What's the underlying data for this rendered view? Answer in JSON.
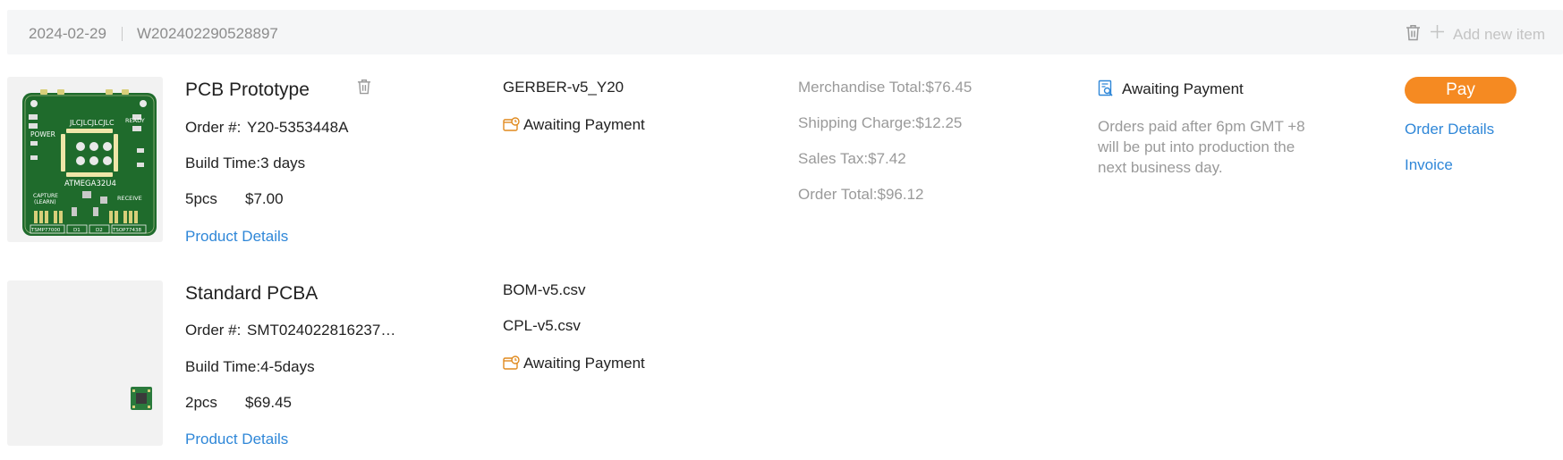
{
  "header": {
    "date": "2024-02-29",
    "order_number": "W202402290528897",
    "add_item_label": "Add new item"
  },
  "items": [
    {
      "board_text": {
        "power": "POWER",
        "ready": "READY",
        "brand": "JLCJLCJLCJLC",
        "chip": "ATMEGA32U4",
        "capture": "CAPTURE",
        "learn": "(LEARN)",
        "receive": "RECEIVE",
        "tsop1": "TSMP77000",
        "d1": "D1",
        "d2": "D2",
        "tsop2": "TSOP77438"
      },
      "title": "PCB Prototype",
      "order_label": "Order #:",
      "order_value": "Y20-5353448A",
      "build_time": "Build Time:3 days",
      "qty": "5pcs",
      "price": "$7.00",
      "details_link": "Product Details",
      "file": "GERBER-v5_Y20",
      "file_status": "Awaiting Payment"
    },
    {
      "title": "Standard PCBA",
      "order_label": "Order #:",
      "order_value": "SMT024022816237…",
      "build_time": "Build Time:4-5days",
      "qty": "2pcs",
      "price": "$69.45",
      "details_link": "Product Details",
      "files": [
        "BOM-v5.csv",
        "CPL-v5.csv"
      ],
      "file_status": "Awaiting Payment"
    }
  ],
  "summary": {
    "merchandise": "Merchandise Total:$76.45",
    "shipping": "Shipping Charge:$12.25",
    "tax": "Sales Tax:$7.42",
    "total": "Order Total:$96.12"
  },
  "status": {
    "label": "Awaiting Payment",
    "note": "Orders paid after 6pm GMT +8 will be put into production the next business day."
  },
  "actions": {
    "pay": "Pay",
    "order_details": "Order Details",
    "invoice": "Invoice"
  },
  "icons": {
    "delete": "trash-icon",
    "add": "plus-icon",
    "status": "document-search-icon",
    "file_status": "wallet-clock-icon"
  },
  "colors": {
    "accent": "#2f87d8",
    "pay_button": "#f58a22",
    "pcb_green": "#1f6b2c",
    "header_bg": "#f5f6f7"
  }
}
